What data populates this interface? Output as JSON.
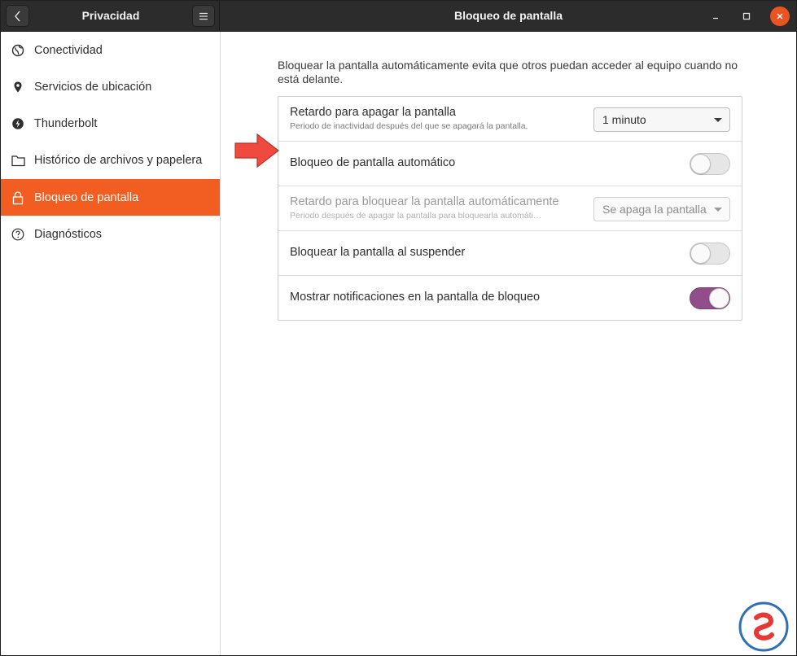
{
  "titlebar": {
    "left_title": "Privacidad",
    "right_title": "Bloqueo de pantalla",
    "back_icon": "chevron-left-icon",
    "menu_icon": "hamburger-menu-icon",
    "close_color": "#e95420"
  },
  "sidebar": {
    "items": [
      {
        "label": "Conectividad",
        "icon": "globe-icon",
        "active": false
      },
      {
        "label": "Servicios de ubicación",
        "icon": "location-pin-icon",
        "active": false
      },
      {
        "label": "Thunderbolt",
        "icon": "thunderbolt-icon",
        "active": false
      },
      {
        "label": "Histórico de archivos y papelera",
        "icon": "folder-icon",
        "active": false
      },
      {
        "label": "Bloqueo de pantalla",
        "icon": "lock-icon",
        "active": true
      },
      {
        "label": "Diagnósticos",
        "icon": "question-circle-icon",
        "active": false
      }
    ],
    "active_color": "#f25d21"
  },
  "main": {
    "description": "Bloquear la pantalla automáticamente evita que otros puedan acceder al equipo cuando no está delante.",
    "rows": [
      {
        "title": "Retardo para apagar la pantalla",
        "subtitle": "Periodo de inactividad después del que se apagará la pantalla.",
        "control": "combo",
        "value": "1 minuto",
        "enabled": true
      },
      {
        "title": "Bloqueo de pantalla automático",
        "control": "switch",
        "on": false,
        "enabled": true
      },
      {
        "title": "Retardo para bloquear la pantalla automáticamente",
        "subtitle": "Periodo después de apagar la pantalla para bloquearla automáti…",
        "control": "combo",
        "value": "Se apaga la pantalla",
        "enabled": false
      },
      {
        "title": "Bloquear la pantalla al suspender",
        "control": "switch",
        "on": false,
        "enabled": true
      },
      {
        "title": "Mostrar notificaciones en la pantalla de bloqueo",
        "control": "switch",
        "on": true,
        "enabled": true
      }
    ],
    "switch_on_color": "#924d8b"
  },
  "annotation": {
    "icon": "red-arrow-icon",
    "color": "#f04a3e"
  },
  "watermark": {
    "icon": "solvetic-logo-icon"
  }
}
